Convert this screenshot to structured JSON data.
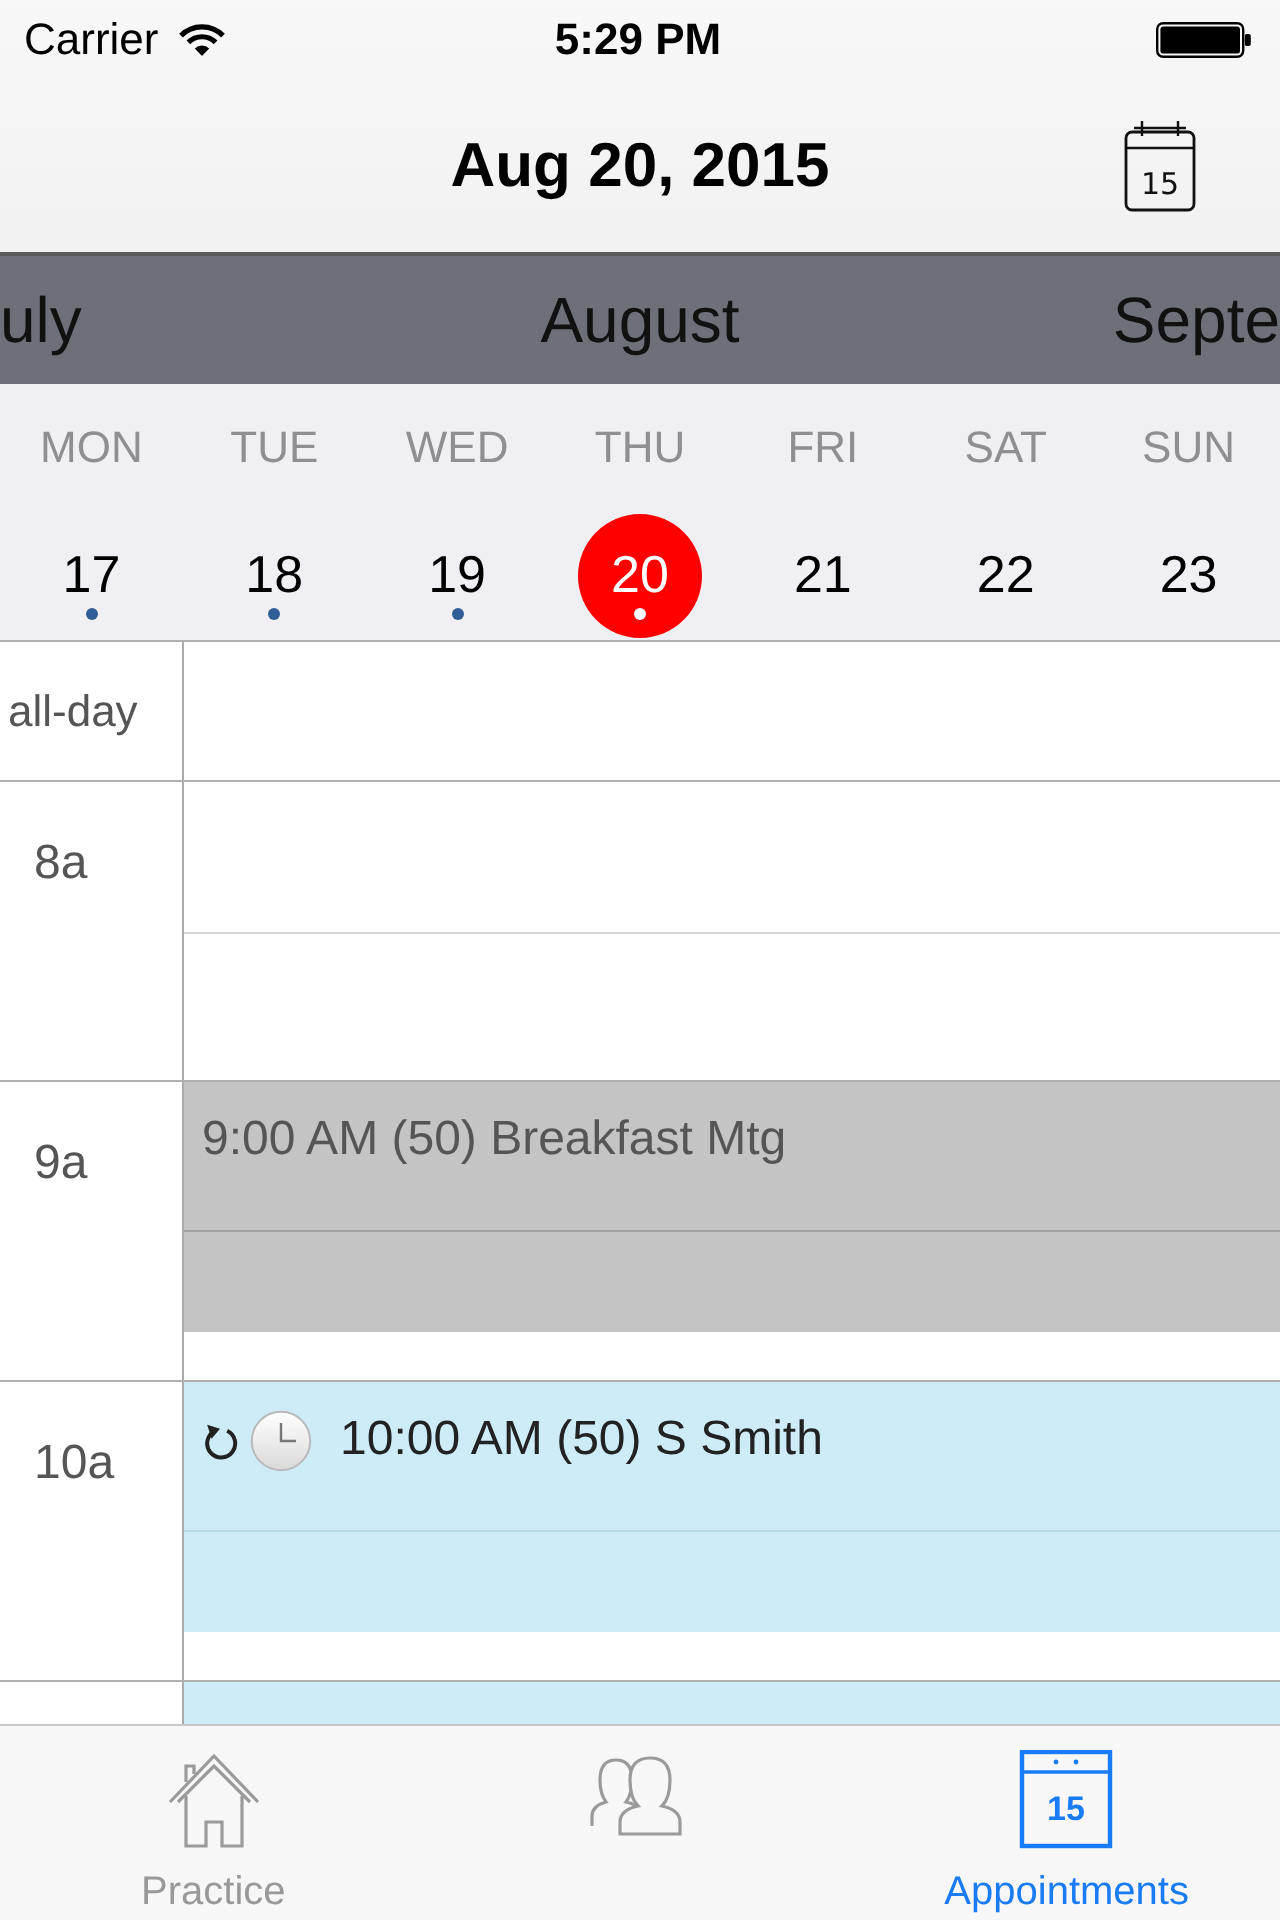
{
  "status_bar": {
    "carrier": "Carrier",
    "time": "5:29 PM"
  },
  "nav": {
    "title": "Aug 20, 2015",
    "today_button": {
      "day": "15"
    }
  },
  "months": [
    "uly",
    "August",
    "Septe"
  ],
  "week": {
    "days": [
      {
        "name": "MON",
        "date": "17",
        "has_events": true,
        "selected": false
      },
      {
        "name": "TUE",
        "date": "18",
        "has_events": true,
        "selected": false
      },
      {
        "name": "WED",
        "date": "19",
        "has_events": true,
        "selected": false
      },
      {
        "name": "THU",
        "date": "20",
        "has_events": true,
        "selected": true
      },
      {
        "name": "FRI",
        "date": "21",
        "has_events": false,
        "selected": false
      },
      {
        "name": "SAT",
        "date": "22",
        "has_events": false,
        "selected": false
      },
      {
        "name": "SUN",
        "date": "23",
        "has_events": false,
        "selected": false
      }
    ]
  },
  "schedule": {
    "all_day": {
      "label": "all-day"
    },
    "hours": [
      {
        "label": "8a"
      },
      {
        "label": "9a",
        "events": [
          {
            "kind": "blocked",
            "title": "9:00 AM (50) Breakfast Mtg",
            "recurring": false,
            "reminder": false
          }
        ]
      },
      {
        "label": "10a",
        "events": [
          {
            "kind": "appointment",
            "title": "10:00 AM (50) S Smith",
            "recurring": true,
            "reminder": true
          }
        ]
      },
      {
        "events": [
          {
            "kind": "appointment"
          }
        ]
      }
    ]
  },
  "tabs": [
    {
      "label": "Practice",
      "selected": false
    },
    {
      "selected": false
    },
    {
      "label": "Appointments",
      "icon_day": "15",
      "selected": true
    }
  ]
}
